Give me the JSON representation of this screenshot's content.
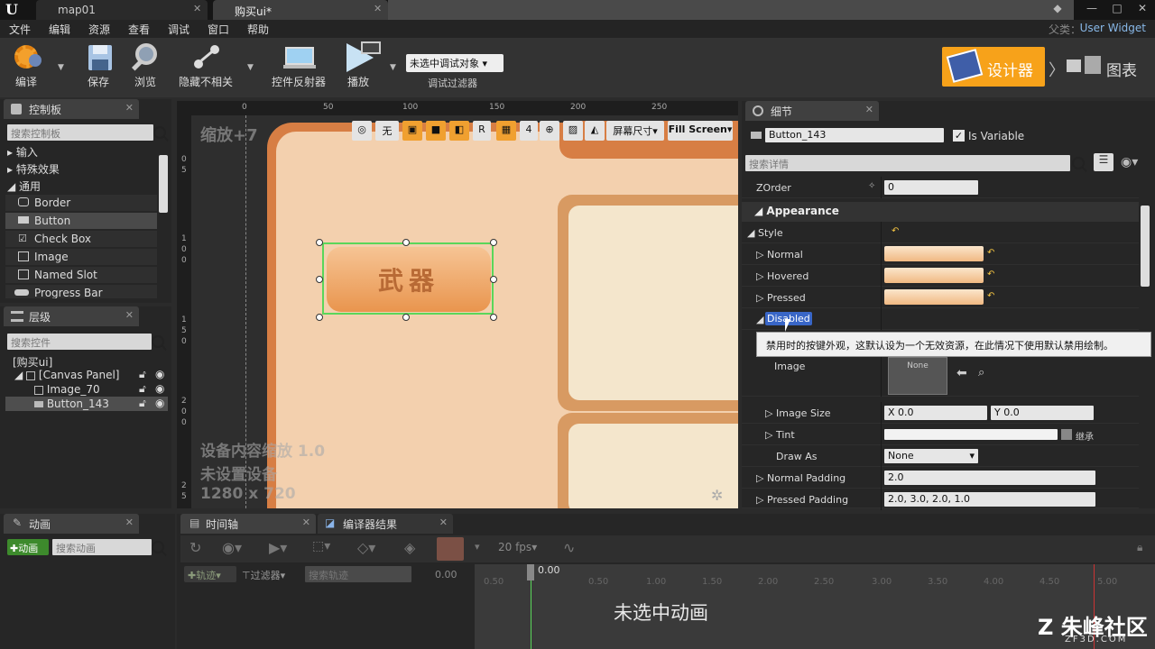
{
  "tabs": [
    {
      "label": "map01",
      "active": false
    },
    {
      "label": "购买ui*",
      "active": true
    }
  ],
  "menu": [
    "文件",
    "编辑",
    "资源",
    "查看",
    "调试",
    "窗口",
    "帮助"
  ],
  "parent": {
    "label": "父类：",
    "value": "User Widget"
  },
  "toolbar": {
    "compile": "编译",
    "save": "保存",
    "browse": "浏览",
    "hide_unrelated": "隐藏不相关",
    "widget_reflector": "控件反射器",
    "play": "播放",
    "debug_select": "未选中调试对象",
    "debug_filter": "调试过滤器"
  },
  "modes": {
    "designer": "设计器",
    "graph": "图表"
  },
  "palette": {
    "title": "控制板",
    "search_placeholder": "搜索控制板",
    "categories": [
      "输入",
      "特殊效果",
      "通用"
    ],
    "items": [
      "Border",
      "Button",
      "Check Box",
      "Image",
      "Named Slot",
      "Progress Bar"
    ]
  },
  "hierarchy": {
    "title": "层级",
    "search_placeholder": "搜索控件",
    "rows": [
      "[购买ui]",
      "[Canvas Panel]",
      "Image_70",
      "Button_143"
    ]
  },
  "canvas": {
    "zoom": "缩放+7",
    "ruler_top": [
      "0",
      "50",
      "100",
      "150",
      "200",
      "250"
    ],
    "ruler_left": [
      "0",
      "5",
      "1",
      "0",
      "0",
      "1",
      "5",
      "0",
      "2",
      "0",
      "0",
      "2",
      "5"
    ],
    "toolbar": {
      "none": "无",
      "r": "R",
      "four": "4",
      "screen_size": "屏幕尺寸",
      "fill_screen": "Fill Screen"
    },
    "button_text": "武器",
    "note_line1": "设备内容缩放 1.0",
    "note_line2": "未设置设备",
    "note_line3": "1280 x 720"
  },
  "details": {
    "title": "细节",
    "name_value": "Button_143",
    "is_variable": "Is Variable",
    "search_placeholder": "搜索详情",
    "zorder_label": "ZOrder",
    "zorder_value": "0",
    "section_appearance": "Appearance",
    "style": "Style",
    "normal": "Normal",
    "hovered": "Hovered",
    "pressed": "Pressed",
    "disabled": "Disabled",
    "tooltip": "禁用时的按键外观，这默认设为一个无效资源，在此情况下使用默认禁用绘制。",
    "image": "Image",
    "image_none": "None",
    "image_size": "Image Size",
    "size_x": "X  0.0",
    "size_y": "Y  0.0",
    "tint": "Tint",
    "tint_inherit": "继承",
    "draw_as": "Draw As",
    "draw_as_value": "None",
    "normal_padding": "Normal Padding",
    "normal_padding_value": "2.0",
    "pressed_padding": "Pressed Padding",
    "pressed_padding_value": "2.0, 3.0, 2.0, 1.0"
  },
  "animation": {
    "title": "动画",
    "add_button": "动画",
    "search_placeholder": "搜索动画"
  },
  "timeline": {
    "tab_timeline": "时间轴",
    "tab_compiler": "编译器结果",
    "fps": "20 fps",
    "track_button": "轨迹",
    "filter_button": "过滤器",
    "search_placeholder": "搜索轨迹",
    "time_value": "0.00",
    "marker": "0.00",
    "ticks": [
      "0.50",
      "0.50",
      "1.00",
      "1.50",
      "2.00",
      "2.50",
      "3.00",
      "3.50",
      "4.00",
      "4.50",
      "5.00"
    ],
    "no_animation": "未选中动画"
  },
  "watermark": {
    "text": "朱峰社区",
    "sub": "ZF3D.COM"
  }
}
